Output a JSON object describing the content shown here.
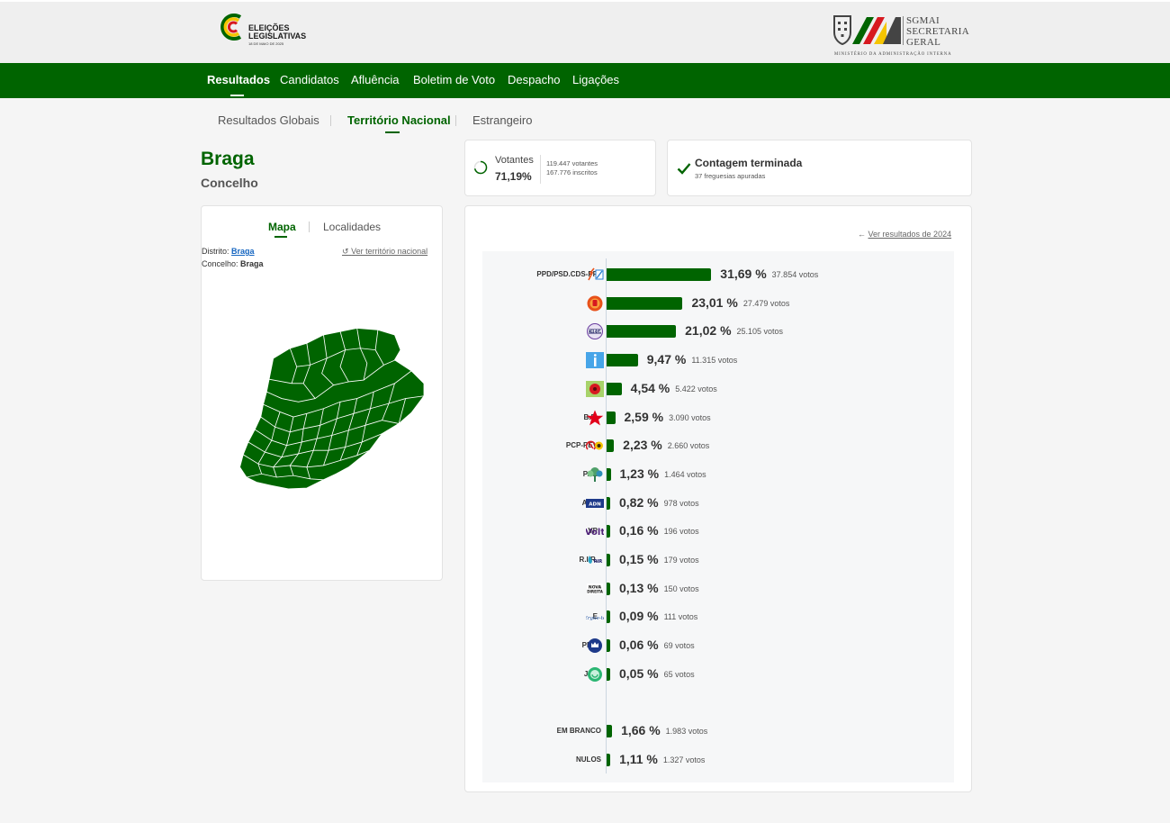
{
  "brand": {
    "logo_line1": "ELEIÇÕES",
    "logo_line2": "LEGISLATIVAS",
    "logo_date": "18 DE MAIO DE 2025",
    "sg_line1": "SGMAI",
    "sg_line2": "SECRETARIA",
    "sg_line3": "GERAL",
    "sg_sub": "MINISTÉRIO DA ADMINISTRAÇÃO INTERNA"
  },
  "nav": [
    "Resultados",
    "Candidatos",
    "Afluência",
    "Boletim de Voto",
    "Despacho",
    "Ligações"
  ],
  "subtabs": [
    "Resultados Globais",
    "Território Nacional",
    "Estrangeiro"
  ],
  "place": {
    "title": "Braga",
    "subtitle": "Concelho"
  },
  "map_panel": {
    "tab_map": "Mapa",
    "tab_places": "Localidades",
    "distrito_label": "Distrito:",
    "distrito_value": "Braga",
    "concelho_label": "Concelho:",
    "concelho_value": "Braga",
    "ver_nacional": "Ver território nacional"
  },
  "votantes": {
    "label": "Votantes",
    "pct": "71,19%",
    "votantes_text": "119.447 votantes",
    "inscritos_text": "167.776 inscritos",
    "progress": 0.7119
  },
  "contagem": {
    "title": "Contagem terminada",
    "sub": "37 freguesias apuradas"
  },
  "results": {
    "ver_2024": "Ver resultados de 2024",
    "colors": {
      "bar": "#006400",
      "accent": "#006400"
    },
    "parties": [
      {
        "name": "PPD/PSD.CDS-PP",
        "pct": 31.69,
        "pct_text": "31,69 %",
        "votes_text": "37.854 votos",
        "logo": "psd-arrow-icon"
      },
      {
        "name": "PS",
        "pct": 23.01,
        "pct_text": "23,01 %",
        "votes_text": "27.479 votos",
        "logo": "ps-fist-icon"
      },
      {
        "name": "CH",
        "pct": 21.02,
        "pct_text": "21,02 %",
        "votes_text": "25.105 votos",
        "logo": "chega-badge-icon"
      },
      {
        "name": "IL",
        "pct": 9.47,
        "pct_text": "9,47 %",
        "votes_text": "11.315 votos",
        "logo": "il-i-icon"
      },
      {
        "name": "L",
        "pct": 4.54,
        "pct_text": "4,54 %",
        "votes_text": "5.422 votos",
        "logo": "livre-flower-icon"
      },
      {
        "name": "B.E.",
        "pct": 2.59,
        "pct_text": "2,59 %",
        "votes_text": "3.090 votos",
        "logo": "be-star-icon"
      },
      {
        "name": "PCP-PEV",
        "pct": 2.23,
        "pct_text": "2,23 %",
        "votes_text": "2.660 votos",
        "logo": "cdu-hammer-sunflower-icon"
      },
      {
        "name": "PAN",
        "pct": 1.23,
        "pct_text": "1,23 %",
        "votes_text": "1.464 votos",
        "logo": "pan-tree-icon"
      },
      {
        "name": "ADN",
        "pct": 0.82,
        "pct_text": "0,82 %",
        "votes_text": "978 votos",
        "logo": "adn-flag-icon"
      },
      {
        "name": "VP",
        "pct": 0.16,
        "pct_text": "0,16 %",
        "votes_text": "196 votos",
        "logo": "volt-text-icon"
      },
      {
        "name": "R.I.R.",
        "pct": 0.15,
        "pct_text": "0,15 %",
        "votes_text": "179 votos",
        "logo": "rir-drop-icon"
      },
      {
        "name": "ND",
        "pct": 0.13,
        "pct_text": "0,13 %",
        "votes_text": "150 votos",
        "logo": "nova-direita-icon"
      },
      {
        "name": "E",
        "pct": 0.09,
        "pct_text": "0,09 %",
        "votes_text": "111 votos",
        "logo": "ergue-te-icon"
      },
      {
        "name": "PPM",
        "pct": 0.06,
        "pct_text": "0,06 %",
        "votes_text": "69 votos",
        "logo": "ppm-crown-icon"
      },
      {
        "name": "JPP",
        "pct": 0.05,
        "pct_text": "0,05 %",
        "votes_text": "65 votos",
        "logo": "jpp-circle-icon"
      }
    ],
    "extras": [
      {
        "name": "EM BRANCO",
        "pct": 1.66,
        "pct_text": "1,66 %",
        "votes_text": "1.983 votos"
      },
      {
        "name": "NULOS",
        "pct": 1.11,
        "pct_text": "1,11 %",
        "votes_text": "1.327 votos"
      }
    ]
  }
}
